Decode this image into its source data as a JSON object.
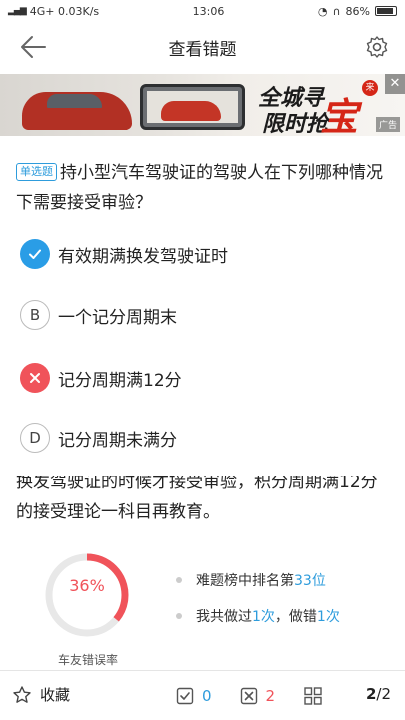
{
  "status_bar": {
    "carrier": "4G+ 0.03K/s",
    "time": "13:06",
    "battery": "86%"
  },
  "nav": {
    "title": "查看错题"
  },
  "ad": {
    "headline_1": "全城寻",
    "headline_2": "限时抢",
    "highlight": "宝",
    "badge": "来",
    "label": "广告"
  },
  "question": {
    "type_tag": "单选题",
    "text": "持小型汽车驾驶证的驾驶人在下列哪种情况下需要接受审验？"
  },
  "options": [
    {
      "key": "A",
      "text": "有效期满换发驾驶证时",
      "state": "correct"
    },
    {
      "key": "B",
      "text": "一个记分周期末",
      "state": "plain"
    },
    {
      "key": "C",
      "text": "记分周期满12分",
      "state": "wrong"
    },
    {
      "key": "D",
      "text": "记分周期未满分",
      "state": "plain"
    }
  ],
  "explanation": "换发驾驶证的时候才接受审验，积分周期满12分的接受理论一科目再教育。",
  "stats": {
    "error_rate": "36%",
    "error_rate_value": 0.36,
    "error_rate_caption": "车友错误率",
    "rank_prefix": "难题榜中排名第",
    "rank_value": "33位",
    "done_prefix": "我共做过",
    "done_count": "1次",
    "wrong_prefix": "，做错",
    "wrong_count": "1次"
  },
  "bottom_bar": {
    "favorite_label": "收藏",
    "correct_count": "0",
    "wrong_count": "2",
    "page_current": "2",
    "page_total": "/2"
  },
  "colors": {
    "accent_blue": "#2e9cdc",
    "error_red": "#f0535a"
  }
}
